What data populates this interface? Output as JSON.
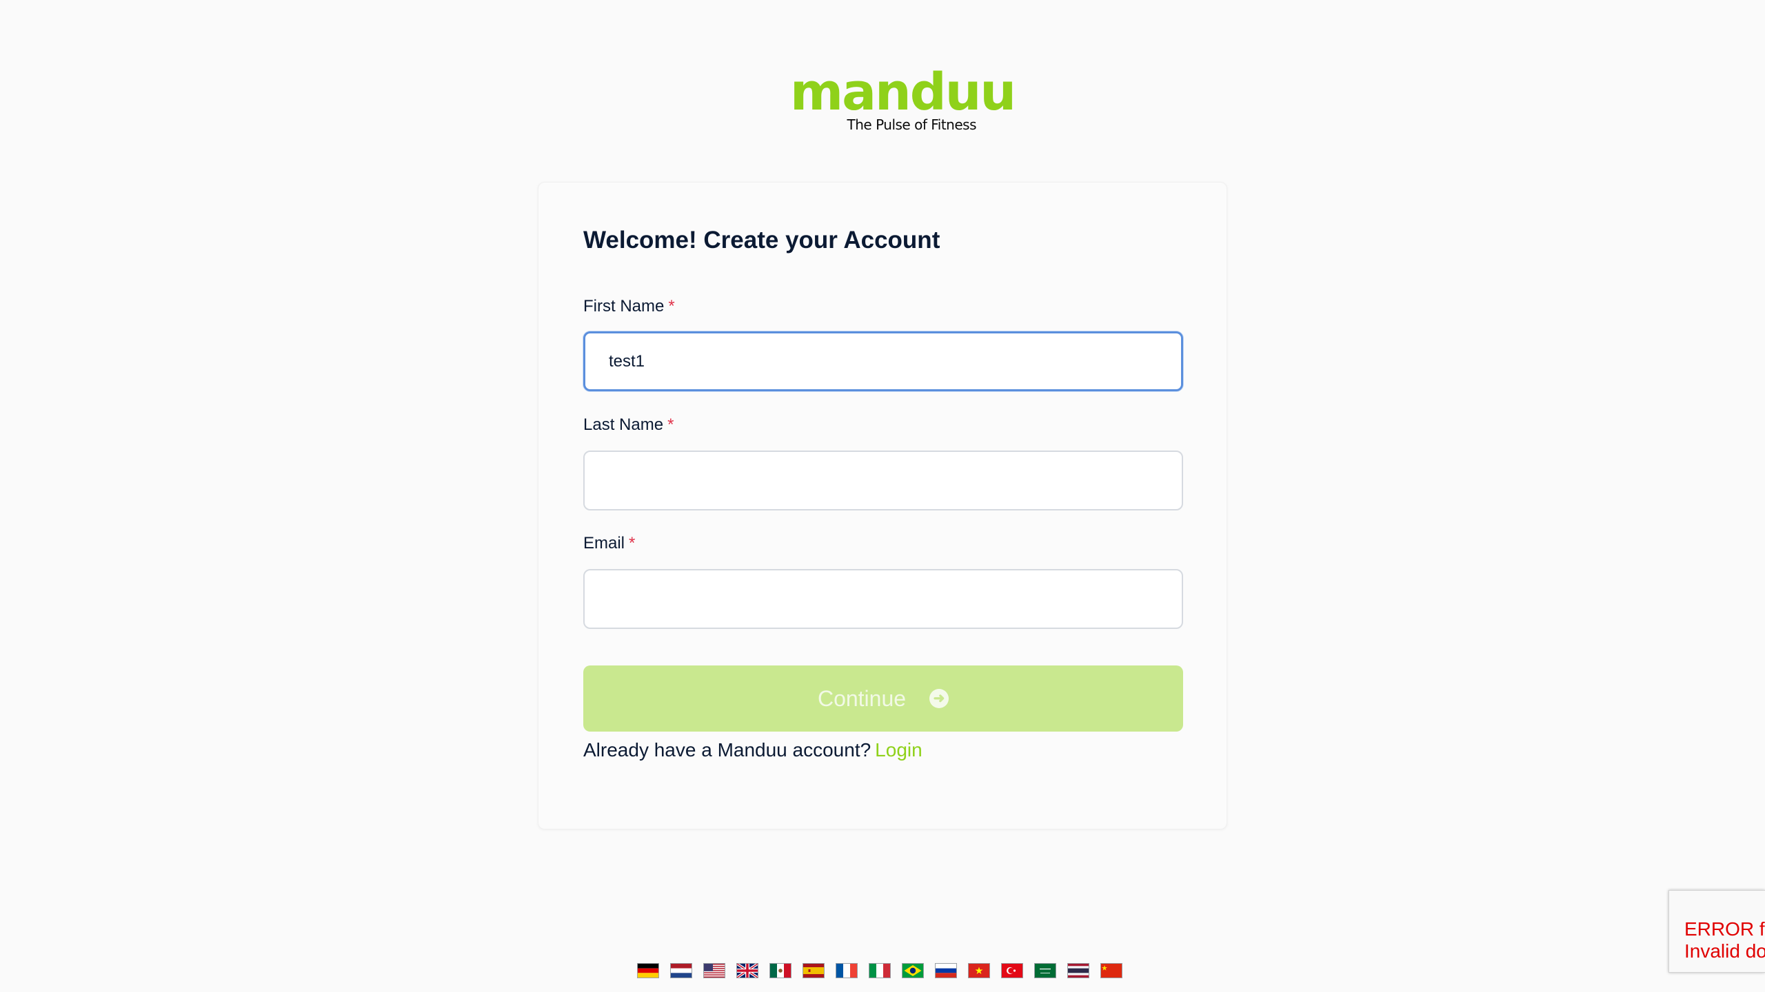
{
  "logo": {
    "word": "manduu",
    "tagline": "The Pulse of Fitness"
  },
  "form": {
    "title": "Welcome! Create your Account",
    "fields": [
      {
        "label": "First Name",
        "required_mark": "*",
        "value": "test1",
        "placeholder": ""
      },
      {
        "label": "Last Name",
        "required_mark": "*",
        "value": "",
        "placeholder": ""
      },
      {
        "label": "Email",
        "required_mark": "*",
        "value": "",
        "placeholder": ""
      }
    ],
    "continue_label": "Continue",
    "login_prompt": "Already have a Manduu account?",
    "login_link": "Login"
  },
  "languages": [
    {
      "name": "German",
      "icon": "flag-de-icon"
    },
    {
      "name": "Dutch",
      "icon": "flag-nl-icon"
    },
    {
      "name": "English (US)",
      "icon": "flag-us-icon"
    },
    {
      "name": "English (UK)",
      "icon": "flag-gb-icon"
    },
    {
      "name": "Spanish (Mexico)",
      "icon": "flag-mx-icon"
    },
    {
      "name": "Spanish (Spain)",
      "icon": "flag-es-icon"
    },
    {
      "name": "French",
      "icon": "flag-fr-icon"
    },
    {
      "name": "Italian",
      "icon": "flag-it-icon"
    },
    {
      "name": "Portuguese (Brazil)",
      "icon": "flag-br-icon"
    },
    {
      "name": "Russian",
      "icon": "flag-ru-icon"
    },
    {
      "name": "Vietnamese",
      "icon": "flag-vn-icon"
    },
    {
      "name": "Turkish",
      "icon": "flag-tr-icon"
    },
    {
      "name": "Arabic",
      "icon": "flag-sa-icon"
    },
    {
      "name": "Thai",
      "icon": "flag-th-icon"
    },
    {
      "name": "Chinese",
      "icon": "flag-cn-icon"
    }
  ],
  "recaptcha": {
    "line1": "ERROR fo",
    "line2": "Invalid do"
  },
  "colors": {
    "brand_green": "#8fd11a",
    "button_disabled": "#c9e88f",
    "required_red": "#e0344b",
    "focus_blue": "#5b8fdd",
    "error_red": "#e00000"
  }
}
